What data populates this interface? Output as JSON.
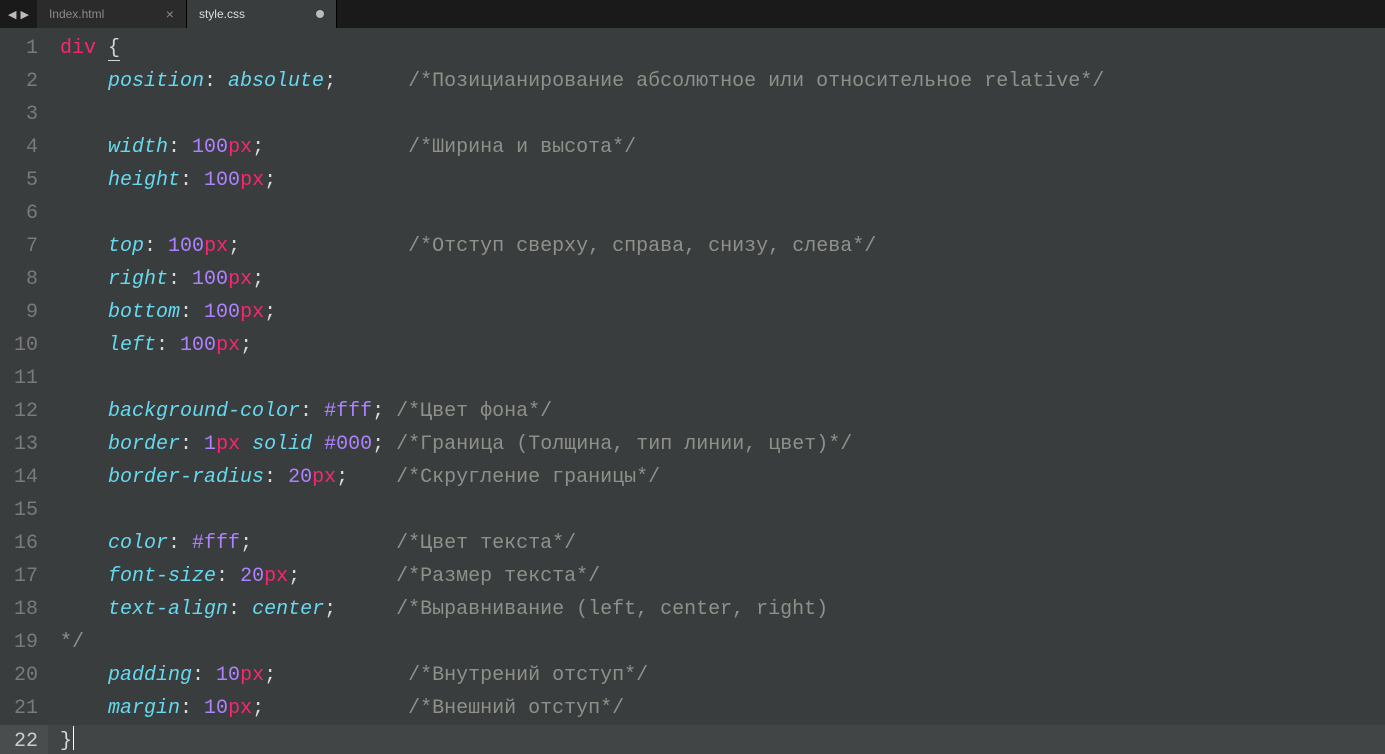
{
  "nav": {
    "left": "◀",
    "right": "▶"
  },
  "tabs": [
    {
      "label": "Index.html",
      "active": false,
      "dirty": false
    },
    {
      "label": "style.css",
      "active": true,
      "dirty": true
    }
  ],
  "cursor_line": 22,
  "lines": [
    {
      "n": 1,
      "tokens": [
        [
          "sel",
          "div"
        ],
        [
          "punc",
          " "
        ],
        [
          "punc under",
          "{"
        ]
      ]
    },
    {
      "n": 2,
      "tokens": [
        [
          "punc",
          "    "
        ],
        [
          "prop",
          "position"
        ],
        [
          "punc",
          ": "
        ],
        [
          "val",
          "absolute"
        ],
        [
          "punc",
          ";"
        ],
        [
          "punc",
          "      "
        ],
        [
          "com",
          "/*Позицианирование абсолютное или относительное relative*/"
        ]
      ]
    },
    {
      "n": 3,
      "tokens": []
    },
    {
      "n": 4,
      "tokens": [
        [
          "punc",
          "    "
        ],
        [
          "prop",
          "width"
        ],
        [
          "punc",
          ": "
        ],
        [
          "num",
          "100"
        ],
        [
          "unit",
          "px"
        ],
        [
          "punc",
          ";"
        ],
        [
          "punc",
          "            "
        ],
        [
          "com",
          "/*Ширина и высота*/"
        ]
      ]
    },
    {
      "n": 5,
      "tokens": [
        [
          "punc",
          "    "
        ],
        [
          "prop",
          "height"
        ],
        [
          "punc",
          ": "
        ],
        [
          "num",
          "100"
        ],
        [
          "unit",
          "px"
        ],
        [
          "punc",
          ";"
        ]
      ]
    },
    {
      "n": 6,
      "tokens": []
    },
    {
      "n": 7,
      "tokens": [
        [
          "punc",
          "    "
        ],
        [
          "prop",
          "top"
        ],
        [
          "punc",
          ": "
        ],
        [
          "num",
          "100"
        ],
        [
          "unit",
          "px"
        ],
        [
          "punc",
          ";"
        ],
        [
          "punc",
          "              "
        ],
        [
          "com",
          "/*Отступ сверху, справа, снизу, слева*/"
        ]
      ]
    },
    {
      "n": 8,
      "tokens": [
        [
          "punc",
          "    "
        ],
        [
          "prop",
          "right"
        ],
        [
          "punc",
          ": "
        ],
        [
          "num",
          "100"
        ],
        [
          "unit",
          "px"
        ],
        [
          "punc",
          ";"
        ]
      ]
    },
    {
      "n": 9,
      "tokens": [
        [
          "punc",
          "    "
        ],
        [
          "prop",
          "bottom"
        ],
        [
          "punc",
          ": "
        ],
        [
          "num",
          "100"
        ],
        [
          "unit",
          "px"
        ],
        [
          "punc",
          ";"
        ]
      ]
    },
    {
      "n": 10,
      "tokens": [
        [
          "punc",
          "    "
        ],
        [
          "prop",
          "left"
        ],
        [
          "punc",
          ": "
        ],
        [
          "num",
          "100"
        ],
        [
          "unit",
          "px"
        ],
        [
          "punc",
          ";"
        ]
      ]
    },
    {
      "n": 11,
      "tokens": []
    },
    {
      "n": 12,
      "tokens": [
        [
          "punc",
          "    "
        ],
        [
          "prop",
          "background-color"
        ],
        [
          "punc",
          ": "
        ],
        [
          "num",
          "#fff"
        ],
        [
          "punc",
          ";"
        ],
        [
          "punc",
          " "
        ],
        [
          "com",
          "/*Цвет фона*/"
        ]
      ]
    },
    {
      "n": 13,
      "tokens": [
        [
          "punc",
          "    "
        ],
        [
          "prop",
          "border"
        ],
        [
          "punc",
          ": "
        ],
        [
          "num",
          "1"
        ],
        [
          "unit",
          "px"
        ],
        [
          "punc",
          " "
        ],
        [
          "val",
          "solid"
        ],
        [
          "punc",
          " "
        ],
        [
          "num",
          "#000"
        ],
        [
          "punc",
          ";"
        ],
        [
          "punc",
          " "
        ],
        [
          "com",
          "/*Граница (Толщина, тип линии, цвет)*/"
        ]
      ]
    },
    {
      "n": 14,
      "tokens": [
        [
          "punc",
          "    "
        ],
        [
          "prop",
          "border-radius"
        ],
        [
          "punc",
          ": "
        ],
        [
          "num",
          "20"
        ],
        [
          "unit",
          "px"
        ],
        [
          "punc",
          ";"
        ],
        [
          "punc",
          "    "
        ],
        [
          "com",
          "/*Скругление границы*/"
        ]
      ]
    },
    {
      "n": 15,
      "tokens": []
    },
    {
      "n": 16,
      "tokens": [
        [
          "punc",
          "    "
        ],
        [
          "prop",
          "color"
        ],
        [
          "punc",
          ": "
        ],
        [
          "num",
          "#fff"
        ],
        [
          "punc",
          ";"
        ],
        [
          "punc",
          "            "
        ],
        [
          "com",
          "/*Цвет текста*/"
        ]
      ]
    },
    {
      "n": 17,
      "tokens": [
        [
          "punc",
          "    "
        ],
        [
          "prop",
          "font-size"
        ],
        [
          "punc",
          ": "
        ],
        [
          "num",
          "20"
        ],
        [
          "unit",
          "px"
        ],
        [
          "punc",
          ";"
        ],
        [
          "punc",
          "        "
        ],
        [
          "com",
          "/*Размер текста*/"
        ]
      ]
    },
    {
      "n": 18,
      "tokens": [
        [
          "punc",
          "    "
        ],
        [
          "prop",
          "text-align"
        ],
        [
          "punc",
          ": "
        ],
        [
          "val",
          "center"
        ],
        [
          "punc",
          ";"
        ],
        [
          "punc",
          "     "
        ],
        [
          "com",
          "/*Выравнивание (left, center, right)"
        ]
      ]
    },
    {
      "n": 19,
      "tokens": [
        [
          "com",
          "*/"
        ]
      ]
    },
    {
      "n": 20,
      "tokens": [
        [
          "punc",
          "    "
        ],
        [
          "prop",
          "padding"
        ],
        [
          "punc",
          ": "
        ],
        [
          "num",
          "10"
        ],
        [
          "unit",
          "px"
        ],
        [
          "punc",
          ";"
        ],
        [
          "punc",
          "           "
        ],
        [
          "com",
          "/*Внутрений отступ*/"
        ]
      ]
    },
    {
      "n": 21,
      "tokens": [
        [
          "punc",
          "    "
        ],
        [
          "prop",
          "margin"
        ],
        [
          "punc",
          ": "
        ],
        [
          "num",
          "10"
        ],
        [
          "unit",
          "px"
        ],
        [
          "punc",
          ";"
        ],
        [
          "punc",
          "            "
        ],
        [
          "com",
          "/*Внешний отступ*/"
        ]
      ]
    },
    {
      "n": 22,
      "tokens": [
        [
          "punc",
          "}"
        ]
      ],
      "cursor_after": true
    }
  ]
}
